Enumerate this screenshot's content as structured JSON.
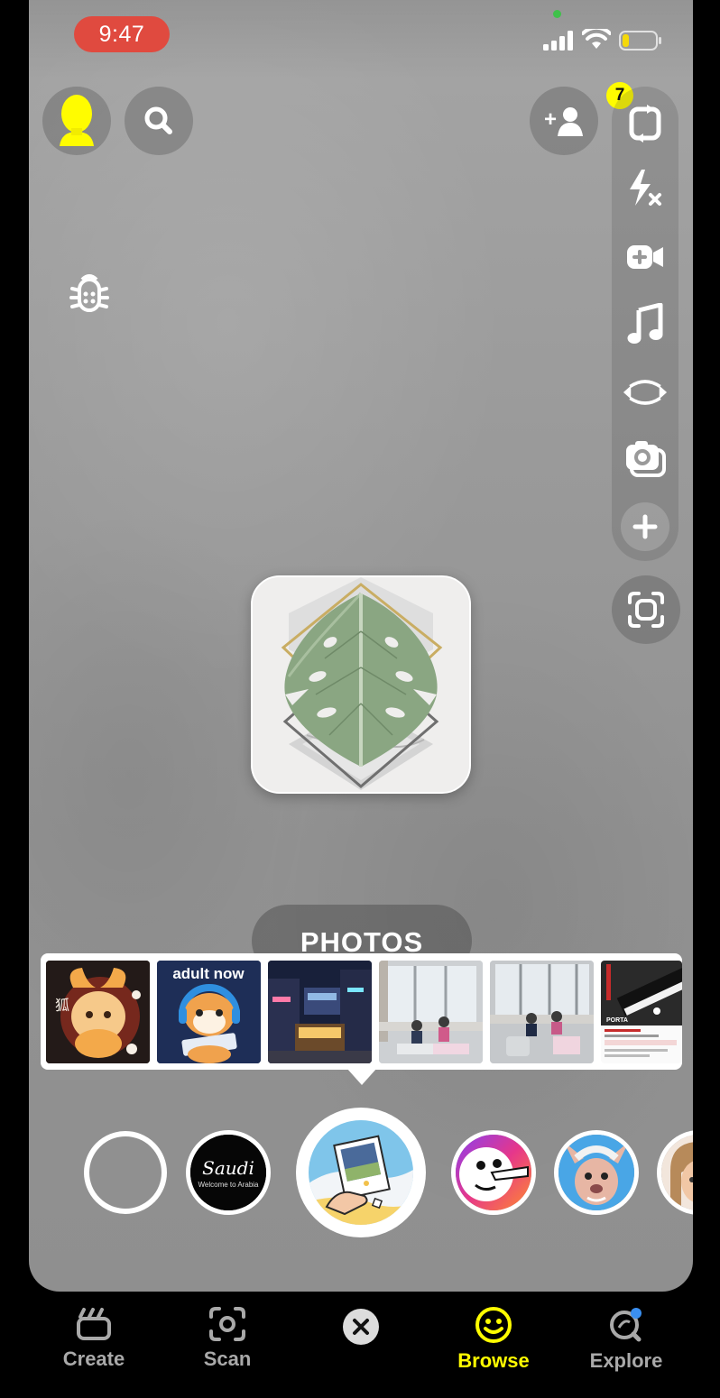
{
  "status_bar": {
    "time": "9:47",
    "time_pill_color": "#e04a3f",
    "camera_indicator_color": "#3fc14a",
    "battery_level": 0.2
  },
  "top_bar": {
    "left": [
      {
        "name": "profile-avatar",
        "icon": "bitmoji-silhouette"
      },
      {
        "name": "search",
        "icon": "search-icon"
      }
    ],
    "add_friend": {
      "icon": "add-friend-icon",
      "badge_count": "7",
      "badge_color": "#fffc00"
    }
  },
  "right_rail": [
    {
      "name": "flip-camera",
      "icon": "flip-camera-icon"
    },
    {
      "name": "flash",
      "icon": "flash-off-icon"
    },
    {
      "name": "video-chat",
      "icon": "video-plus-icon"
    },
    {
      "name": "music",
      "icon": "music-note-icon"
    },
    {
      "name": "dual-camera",
      "icon": "dual-camera-icon"
    },
    {
      "name": "multi-snap",
      "icon": "camera-stack-icon"
    },
    {
      "name": "more",
      "icon": "plus-icon"
    }
  ],
  "scan_button": {
    "icon": "scan-icon"
  },
  "debug_icon": "bug-icon",
  "lens_preview": {
    "image": "monstera-leaf-geometric-art"
  },
  "photos_label": "PHOTOS",
  "photo_strip": [
    {
      "name": "fox-illustration",
      "text": "狐"
    },
    {
      "name": "shiba-gamer",
      "text": "adult now"
    },
    {
      "name": "night-street"
    },
    {
      "name": "kids-room-window-1"
    },
    {
      "name": "kids-room-window-2"
    },
    {
      "name": "keyboard-ad",
      "text": "PORTA"
    }
  ],
  "lens_carousel": [
    {
      "name": "lens-empty"
    },
    {
      "name": "lens-saudi",
      "text_1": "Saudi",
      "text_2": "Welcome to Arabia"
    },
    {
      "name": "lens-selected-photo",
      "selected": true
    },
    {
      "name": "lens-face-nose"
    },
    {
      "name": "lens-dog-face"
    },
    {
      "name": "lens-bitmoji-partial"
    }
  ],
  "bottom_nav": {
    "create": "Create",
    "scan": "Scan",
    "close": "close-icon",
    "browse": "Browse",
    "explore": "Explore",
    "active": "browse",
    "active_color": "#fffc00"
  }
}
